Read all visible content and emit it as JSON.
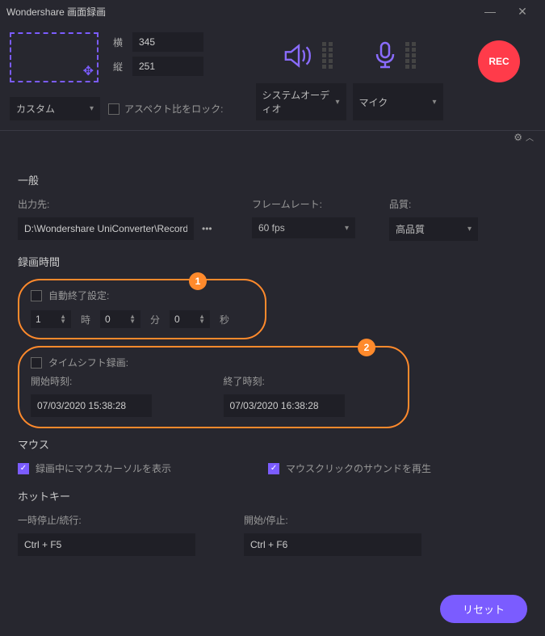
{
  "titlebar": {
    "title": "Wondershare 画面録画"
  },
  "area": {
    "width_label": "横",
    "width_value": "345",
    "height_label": "縦",
    "height_value": "251",
    "mode": "カスタム",
    "aspect_label": "アスペクト比をロック:"
  },
  "audio": {
    "system_label": "システムオーディオ",
    "mic_label": "マイク"
  },
  "rec": {
    "label": "REC"
  },
  "general": {
    "heading": "一般",
    "output_label": "出力先:",
    "output_value": "D:\\Wondershare UniConverter\\Recorder",
    "framerate_label": "フレームレート:",
    "framerate_value": "60 fps",
    "quality_label": "品質:",
    "quality_value": "高品質"
  },
  "rectime": {
    "heading": "録画時間",
    "auto_stop_label": "自動終了設定:",
    "hours": "1",
    "hours_unit": "時",
    "mins": "0",
    "mins_unit": "分",
    "secs": "0",
    "secs_unit": "秒",
    "timeshift_label": "タイムシフト録画:",
    "start_label": "開始時刻:",
    "start_value": "07/03/2020 15:38:28",
    "end_label": "終了時刻:",
    "end_value": "07/03/2020 16:38:28"
  },
  "callouts": {
    "one": "1",
    "two": "2"
  },
  "mouse": {
    "heading": "マウス",
    "show_cursor": "録画中にマウスカーソルを表示",
    "click_sound": "マウスクリックのサウンドを再生"
  },
  "hotkey": {
    "heading": "ホットキー",
    "pause_label": "一時停止/続行:",
    "pause_value": "Ctrl + F5",
    "startstop_label": "開始/停止:",
    "startstop_value": "Ctrl + F6"
  },
  "footer": {
    "reset": "リセット"
  }
}
